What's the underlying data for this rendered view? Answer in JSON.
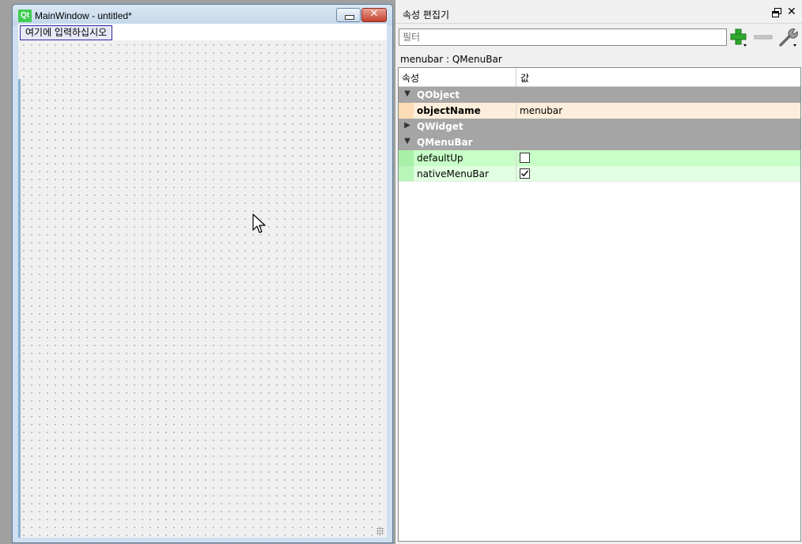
{
  "form": {
    "logo": "Qt",
    "title": "MainWindow - untitled*",
    "menu_placeholder": "여기에 입력하십시오"
  },
  "dock": {
    "title": "속성 편집기",
    "filter_placeholder": "필터",
    "object_label": "menubar : QMenuBar",
    "header_property": "속성",
    "header_value": "값"
  },
  "properties": {
    "group_qobject": "QObject",
    "objectName_label": "objectName",
    "objectName_value": "menubar",
    "group_qwidget": "QWidget",
    "group_qmenubar": "QMenuBar",
    "defaultUp_label": "defaultUp",
    "defaultUp_checked": false,
    "nativeMenuBar_label": "nativeMenuBar",
    "nativeMenuBar_checked": true
  },
  "colors": {
    "qt_green": "#41cd52",
    "group_gray": "#a5a5a5",
    "objectname_row": "#fdeedb",
    "qmenubar_row": "#c8ffc8",
    "add_icon_green": "#2ea82e"
  },
  "icons": [
    "qt-logo-icon",
    "minimize-icon",
    "close-icon",
    "float-icon",
    "dock-close-icon",
    "add-icon",
    "remove-icon",
    "configure-icon",
    "chevron-down-icon",
    "chevron-right-icon",
    "checkbox-icon",
    "cursor-icon"
  ]
}
